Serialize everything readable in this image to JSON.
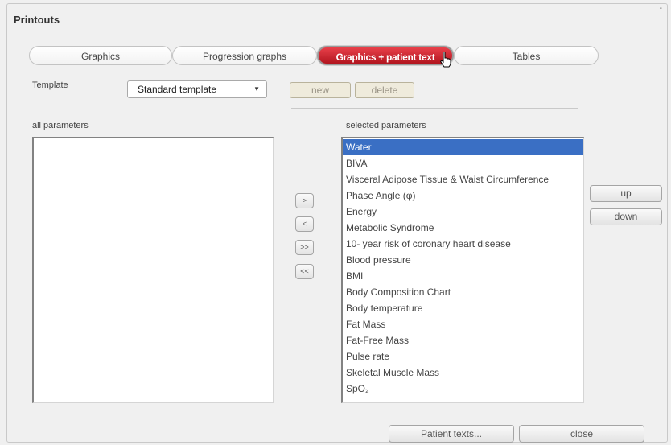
{
  "window": {
    "title": "Printouts",
    "close_glyph": "-"
  },
  "tabs": [
    {
      "label": "Graphics",
      "active": false
    },
    {
      "label": "Progression graphs",
      "active": false
    },
    {
      "label": "Graphics + patient text",
      "active": true
    },
    {
      "label": "Tables",
      "active": false
    }
  ],
  "template": {
    "label": "Template",
    "selected": "Standard template",
    "new_label": "new",
    "delete_label": "delete"
  },
  "all_parameters": {
    "label": "all parameters",
    "items": []
  },
  "selected_parameters": {
    "label": "selected parameters",
    "items": [
      "Water",
      "BIVA",
      "Visceral Adipose Tissue & Waist Circumference",
      "Phase Angle (φ)",
      "Energy",
      "Metabolic Syndrome",
      "10- year risk of coronary heart disease",
      "Blood pressure",
      "BMI",
      "Body Composition Chart",
      "Body temperature",
      "Fat Mass",
      "Fat-Free Mass",
      "Pulse rate",
      "Skeletal Muscle Mass",
      "SpO₂"
    ],
    "selected_index": 0
  },
  "move_buttons": {
    "add": ">",
    "remove": "<",
    "add_all": ">>",
    "remove_all": "<<"
  },
  "order_buttons": {
    "up": "up",
    "down": "down"
  },
  "footer": {
    "patient_texts": "Patient texts...",
    "close": "close"
  },
  "colors": {
    "active_tab": "#c41d27",
    "selection": "#3a6fc4"
  },
  "icons": {
    "cursor": "hand-pointer-icon",
    "dropdown": "chevron-down-icon"
  }
}
